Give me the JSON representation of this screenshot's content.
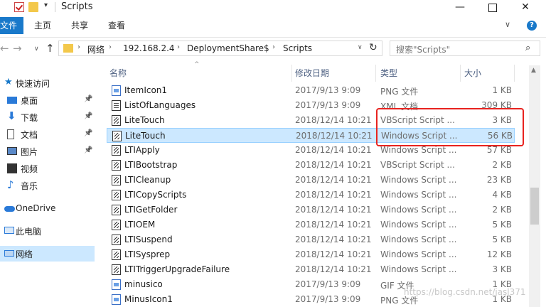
{
  "window": {
    "title": "Scripts",
    "minimize_glyph": "—",
    "close_glyph": "✕"
  },
  "ribbon": {
    "tabs": [
      "文件",
      "主页",
      "共享",
      "查看"
    ],
    "expand_glyph": "∨",
    "help_glyph": "?"
  },
  "address": {
    "crumbs": [
      "网络",
      "192.168.2.4",
      "DeploymentShare$",
      "Scripts"
    ],
    "separator": "›",
    "search_placeholder": "搜索\"Scripts\""
  },
  "icons": {
    "back": "←",
    "forward": "→",
    "recent": "∨",
    "up": "↑",
    "refresh": "↻",
    "search": "⌕",
    "pin": "📌",
    "sort": "^"
  },
  "nav_pane": {
    "quick_access": "快速访问",
    "items": [
      {
        "label": "桌面",
        "pinned": true
      },
      {
        "label": "下载",
        "pinned": true
      },
      {
        "label": "文档",
        "pinned": true
      },
      {
        "label": "图片",
        "pinned": true
      },
      {
        "label": "视频",
        "pinned": false
      },
      {
        "label": "音乐",
        "pinned": false
      }
    ],
    "onedrive": "OneDrive",
    "this_pc": "此电脑",
    "network": "网络"
  },
  "columns": {
    "name": "名称",
    "date": "修改日期",
    "type": "类型",
    "size": "大小"
  },
  "files": [
    {
      "name": "ItemIcon1",
      "date": "2017/9/13 9:09",
      "type": "PNG 文件",
      "size": "1 KB",
      "icon": "img"
    },
    {
      "name": "ListOfLanguages",
      "date": "2017/9/13 9:09",
      "type": "XML 文档",
      "size": "309 KB",
      "icon": "doc"
    },
    {
      "name": "LiteTouch",
      "date": "2018/12/14 10:21",
      "type": "VBScript Script ...",
      "size": "3 KB",
      "icon": "script"
    },
    {
      "name": "LiteTouch",
      "date": "2018/12/14 10:21",
      "type": "Windows Script ...",
      "size": "56 KB",
      "icon": "script",
      "selected": true
    },
    {
      "name": "LTIApply",
      "date": "2018/12/14 10:21",
      "type": "Windows Script ...",
      "size": "57 KB",
      "icon": "script"
    },
    {
      "name": "LTIBootstrap",
      "date": "2018/12/14 10:21",
      "type": "VBScript Script ...",
      "size": "2 KB",
      "icon": "script"
    },
    {
      "name": "LTICleanup",
      "date": "2018/12/14 10:21",
      "type": "Windows Script ...",
      "size": "23 KB",
      "icon": "script"
    },
    {
      "name": "LTICopyScripts",
      "date": "2018/12/14 10:21",
      "type": "Windows Script ...",
      "size": "4 KB",
      "icon": "script"
    },
    {
      "name": "LTIGetFolder",
      "date": "2018/12/14 10:21",
      "type": "Windows Script ...",
      "size": "2 KB",
      "icon": "script"
    },
    {
      "name": "LTIOEM",
      "date": "2018/12/14 10:21",
      "type": "Windows Script ...",
      "size": "5 KB",
      "icon": "script"
    },
    {
      "name": "LTISuspend",
      "date": "2018/12/14 10:21",
      "type": "Windows Script ...",
      "size": "5 KB",
      "icon": "script"
    },
    {
      "name": "LTISysprep",
      "date": "2018/12/14 10:21",
      "type": "Windows Script ...",
      "size": "12 KB",
      "icon": "script"
    },
    {
      "name": "LTITriggerUpgradeFailure",
      "date": "2018/12/14 10:21",
      "type": "Windows Script ...",
      "size": "3 KB",
      "icon": "script"
    },
    {
      "name": "minusico",
      "date": "2017/9/13 9:09",
      "type": "GIF 文件",
      "size": "1 KB",
      "icon": "img"
    },
    {
      "name": "MinusIcon1",
      "date": "2017/9/13 9:09",
      "type": "PNG 文件",
      "size": "1 KB",
      "icon": "img"
    }
  ],
  "watermark": "https://blog.csdn.net/jasl371",
  "colors": {
    "accent": "#1979ca",
    "selection": "#cce8ff",
    "highlight": "#e8231f",
    "folder": "#f3c84b"
  }
}
